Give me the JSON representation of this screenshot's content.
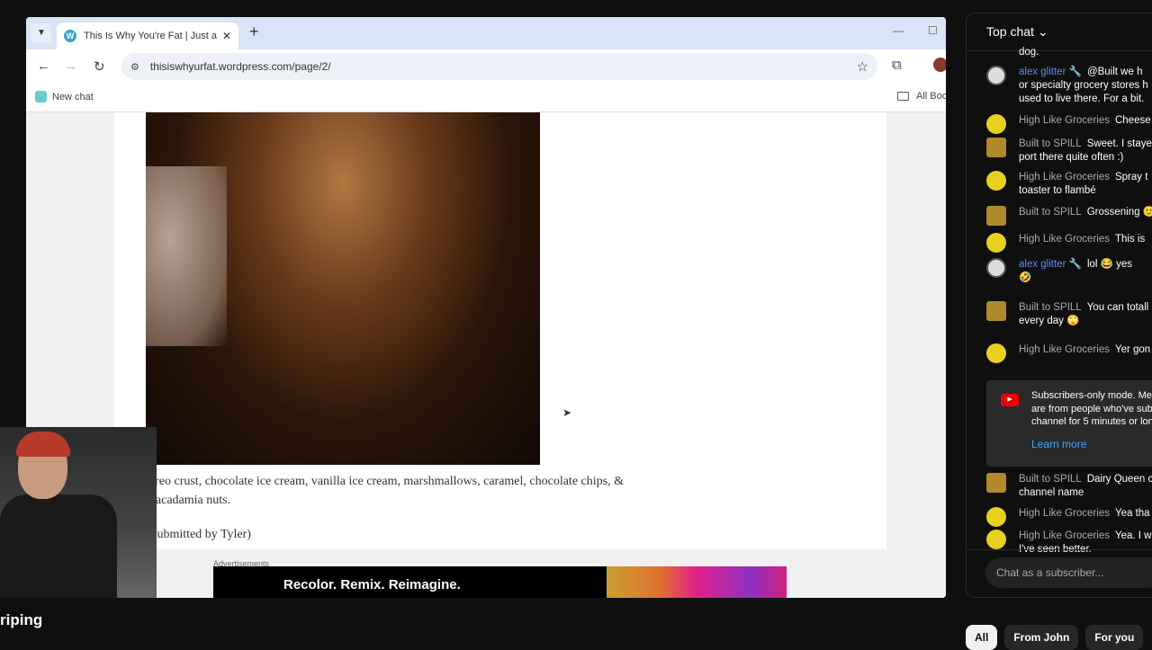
{
  "browser": {
    "tab_title": "This Is Why You're Fat | Just and",
    "url": "thisiswhyurfat.wordpress.com/page/2/",
    "bookmarks": [
      "New chat",
      "All Bookmarks"
    ]
  },
  "post": {
    "caption": "Oreo crust, chocolate ice cream, vanilla ice cream, marshmallows, caramel, chocolate chips, & macadamia nuts.",
    "submitted": "(Submitted by Tyler)"
  },
  "ad": {
    "label": "Advertisements",
    "headline": "Recolor. Remix. Reimagine."
  },
  "stream": {
    "title_fragment": "riping"
  },
  "chat": {
    "header": "Top chat",
    "messages": [
      {
        "author": "",
        "text": "dog."
      },
      {
        "author": "alex glitter 🔧",
        "text": "@Built we h",
        "text2": "or specialty grocery stores h",
        "text3": "used to live there. For a bit."
      },
      {
        "author": "High Like Groceries",
        "text": "Cheese"
      },
      {
        "author": "Built to SPILL",
        "text": "Sweet. I staye",
        "text2": "port there quite often :)"
      },
      {
        "author": "High Like Groceries",
        "text": "Spray t",
        "text2": "toaster to flambé"
      },
      {
        "author": "Built to SPILL",
        "text": "Grossening 🙂"
      },
      {
        "author": "High Like Groceries",
        "text": "This is"
      },
      {
        "author": "alex glitter 🔧",
        "text": "lol 😂 yes",
        "text2": "🤣"
      },
      {
        "author": "Built to SPILL",
        "text": "You can totall",
        "text2": "every day 🙄"
      },
      {
        "author": "High Like Groceries",
        "text": "Yer gon"
      },
      {
        "author": "Built to SPILL",
        "text": "Dairy Queen c",
        "text2": "channel name"
      },
      {
        "author": "High Like Groceries",
        "text": "Yea tha"
      },
      {
        "author": "High Like Groceries",
        "text": "Yea. I w",
        "text2": "I've seen better."
      }
    ],
    "system": {
      "text": "Subscribers-only mode. Mes are from people who've sub channel for 5 minutes or lon",
      "link": "Learn more"
    },
    "input_placeholder": "Chat as a subscriber..."
  },
  "chips": [
    "All",
    "From John",
    "For you"
  ]
}
